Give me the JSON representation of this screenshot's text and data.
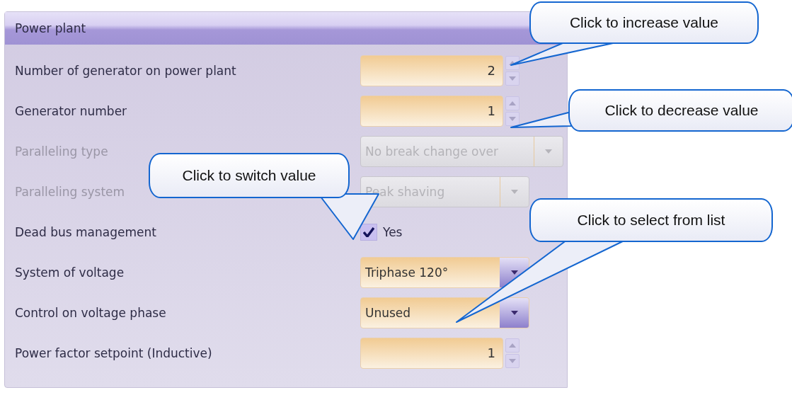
{
  "panel": {
    "title": "Power plant",
    "rows": [
      {
        "label": "Number of generator on power plant",
        "disabled": false,
        "control": {
          "kind": "spinner",
          "value": "2"
        }
      },
      {
        "label": "Generator number",
        "disabled": false,
        "control": {
          "kind": "spinner",
          "value": "1"
        }
      },
      {
        "label": "Paralleling type",
        "disabled": true,
        "control": {
          "kind": "combo",
          "value": "No break change over"
        }
      },
      {
        "label": "Paralleling system",
        "disabled": true,
        "control": {
          "kind": "combo",
          "value": "Peak shaving"
        }
      },
      {
        "label": "Dead bus management",
        "disabled": false,
        "control": {
          "kind": "checkbox",
          "checked": true,
          "value": "Yes"
        }
      },
      {
        "label": "System of voltage",
        "disabled": false,
        "control": {
          "kind": "combo",
          "value": "Triphase 120°"
        }
      },
      {
        "label": "Control on voltage phase",
        "disabled": false,
        "control": {
          "kind": "combo",
          "value": "Unused"
        }
      },
      {
        "label": "Power factor setpoint (Inductive)",
        "disabled": false,
        "control": {
          "kind": "spinner",
          "value": "1"
        }
      }
    ]
  },
  "callouts": [
    {
      "text": "Click to increase value"
    },
    {
      "text": "Click to decrease value"
    },
    {
      "text": "Click to switch value"
    },
    {
      "text": "Click to select from list"
    }
  ]
}
